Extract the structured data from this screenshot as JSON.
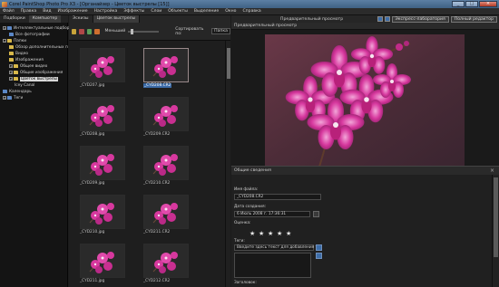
{
  "window": {
    "title": "Corel PaintShop Photo Pro X3 - [Органайзер - Цветок выстрелы [15]]",
    "btn_min": "_",
    "btn_max": "□",
    "btn_close": "×"
  },
  "menu": [
    "Файл",
    "Правка",
    "Вид",
    "Изображение",
    "Настройка",
    "Эффекты",
    "Слои",
    "Объекты",
    "Выделение",
    "Окно",
    "Справка"
  ],
  "left_tabs": [
    "Подборки",
    "Компьютер"
  ],
  "tree": [
    "Интеллектуальные подборки",
    "Все фотографии",
    "Папки",
    "Обзор дополнительных п",
    "Видео",
    "Изображения",
    "Общее видео",
    "Общие изображения",
    "Цветок выстрелы",
    "Icey Canal",
    "Календарь",
    "Теги"
  ],
  "browser_tabs": [
    "Эскизы",
    "Цветок выстрелы"
  ],
  "toolbar": {
    "zoom_label": "Меньший",
    "sort_label": "Сортировать по:",
    "sort_value": "Папка"
  },
  "thumbnails": [
    "_CYD207.jpg",
    "_CYD208.CR2",
    "_CYD208.jpg",
    "_CYD209.CR2",
    "_CYD209.jpg",
    "_CYD210.CR2",
    "_CYD210.jpg",
    "_CYD211.CR2",
    "_CYD211.jpg",
    "_CYD212.CR2"
  ],
  "right_top": {
    "title": "Предварительный просмотр",
    "express_button": "Экспресс-лаборатория",
    "full_editor_button": "Полный редактор"
  },
  "preview_header": "Предварительный просмотр",
  "info": {
    "header": "Общие сведения",
    "filename_label": "Имя файла:",
    "filename": "_CYD208.CR2",
    "date_label": "Дата создания:",
    "date": "6 Июль 2008 г.   17:36:31",
    "rating_label": "Оценка:",
    "rating": 5,
    "star": "★",
    "tags_label": "Теги:",
    "tags_placeholder": "Введите здесь текст для добавления тег",
    "caption_label": "Заголовок:",
    "close": "×"
  },
  "colors": {
    "accent": "#3b6aa6",
    "flower": "#d7389e",
    "background": "#1b1b1b"
  }
}
